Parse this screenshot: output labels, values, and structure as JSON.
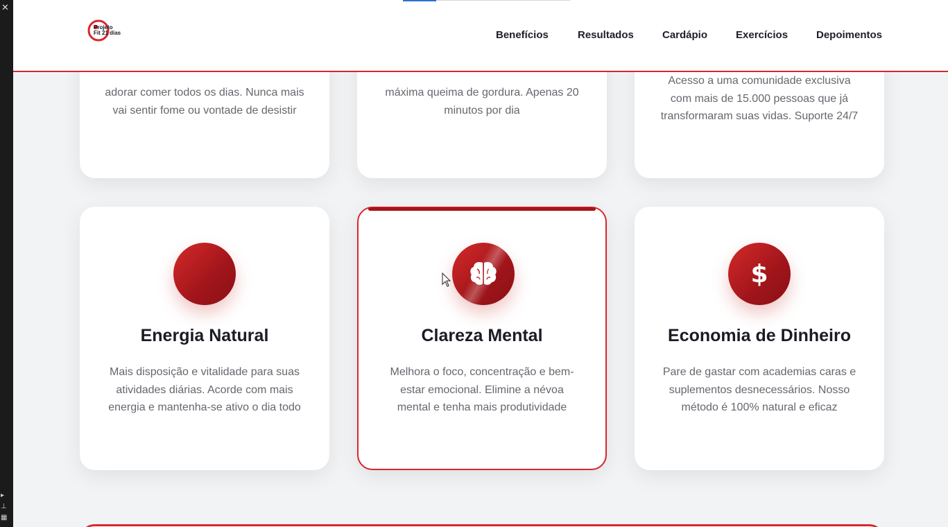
{
  "header": {
    "logo_text_line1": "Projeto",
    "logo_text_line2": "Fit 21 dias",
    "nav": [
      "Benefícios",
      "Resultados",
      "Cardápio",
      "Exercícios",
      "Depoimentos"
    ]
  },
  "top_cards": [
    {
      "desc_visible": "adorar comer todos os dias. Nunca mais vai sentir fome ou vontade de desistir"
    },
    {
      "desc_visible": "máxima queima de gordura. Apenas 20 minutos por dia"
    },
    {
      "desc_visible": "Acesso a uma comunidade exclusiva com mais de 15.000 pessoas que já transformaram suas vidas. Suporte 24/7"
    }
  ],
  "cards": [
    {
      "icon": "plain-circle-icon",
      "title": "Energia Natural",
      "desc": "Mais disposição e vitalidade para suas atividades diárias. Acorde com mais energia e mantenha-se ativo o dia todo"
    },
    {
      "icon": "brain-icon",
      "title": "Clareza Mental",
      "desc": "Melhora o foco, concentração e bem-estar emocional. Elimine a névoa mental e tenha mais produtividade"
    },
    {
      "icon": "dollar-icon",
      "title": "Economia de Dinheiro",
      "desc": "Pare de gastar com academias caras e suplementos desnecessários. Nosso método é 100% natural e eficaz"
    }
  ],
  "colors": {
    "accent": "#d8262c",
    "icon_gradient_dark": "#a0151a",
    "page_bg": "#f2f3f5"
  }
}
